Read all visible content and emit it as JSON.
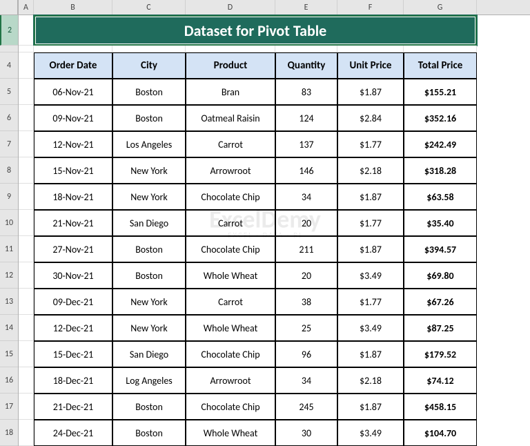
{
  "columns": [
    "A",
    "B",
    "C",
    "D",
    "E",
    "F",
    "G"
  ],
  "colWidths": [
    "wA",
    "wB",
    "wC",
    "wD",
    "wE",
    "wF",
    "wG"
  ],
  "rowNums": [
    2,
    4,
    5,
    6,
    7,
    8,
    9,
    10,
    11,
    12,
    13,
    14,
    15,
    16,
    17,
    18
  ],
  "selectedRow": 2,
  "title": "Dataset for Pivot Table",
  "headers": [
    "Order Date",
    "City",
    "Product",
    "Quantity",
    "Unit Price",
    "Total Price"
  ],
  "rows": [
    {
      "date": "06-Nov-21",
      "city": "Boston",
      "product": "Bran",
      "qty": "83",
      "unit": "$1.87",
      "total": "$155.21"
    },
    {
      "date": "09-Nov-21",
      "city": "Boston",
      "product": "Oatmeal Raisin",
      "qty": "124",
      "unit": "$2.84",
      "total": "$352.16"
    },
    {
      "date": "12-Nov-21",
      "city": "Los Angeles",
      "product": "Carrot",
      "qty": "137",
      "unit": "$1.77",
      "total": "$242.49"
    },
    {
      "date": "15-Nov-21",
      "city": "New York",
      "product": "Arrowroot",
      "qty": "146",
      "unit": "$2.18",
      "total": "$318.28"
    },
    {
      "date": "18-Nov-21",
      "city": "New York",
      "product": "Chocolate Chip",
      "qty": "34",
      "unit": "$1.87",
      "total": "$63.58"
    },
    {
      "date": "21-Nov-21",
      "city": "San Diego",
      "product": "Carrot",
      "qty": "20",
      "unit": "$1.77",
      "total": "$35.40"
    },
    {
      "date": "27-Nov-21",
      "city": "Boston",
      "product": "Chocolate Chip",
      "qty": "211",
      "unit": "$1.87",
      "total": "$394.57"
    },
    {
      "date": "30-Nov-21",
      "city": "Boston",
      "product": "Whole Wheat",
      "qty": "20",
      "unit": "$3.49",
      "total": "$69.80"
    },
    {
      "date": "09-Dec-21",
      "city": "New York",
      "product": "Carrot",
      "qty": "38",
      "unit": "$1.77",
      "total": "$67.26"
    },
    {
      "date": "12-Dec-21",
      "city": "New York",
      "product": "Whole Wheat",
      "qty": "25",
      "unit": "$3.49",
      "total": "$87.25"
    },
    {
      "date": "15-Dec-21",
      "city": "San Diego",
      "product": "Chocolate Chip",
      "qty": "96",
      "unit": "$1.87",
      "total": "$179.52"
    },
    {
      "date": "18-Dec-21",
      "city": "Log Angeles",
      "product": "Arrowroot",
      "qty": "34",
      "unit": "$2.18",
      "total": "$74.12"
    },
    {
      "date": "21-Dec-21",
      "city": "Boston",
      "product": "Chocolate Chip",
      "qty": "245",
      "unit": "$1.87",
      "total": "$458.15"
    },
    {
      "date": "24-Dec-21",
      "city": "Boston",
      "product": "Whole Wheat",
      "qty": "30",
      "unit": "$3.49",
      "total": "$104.70"
    }
  ],
  "watermark": {
    "main": "ExcelDemy",
    "sub": "EXCEL · DATA · BI"
  }
}
